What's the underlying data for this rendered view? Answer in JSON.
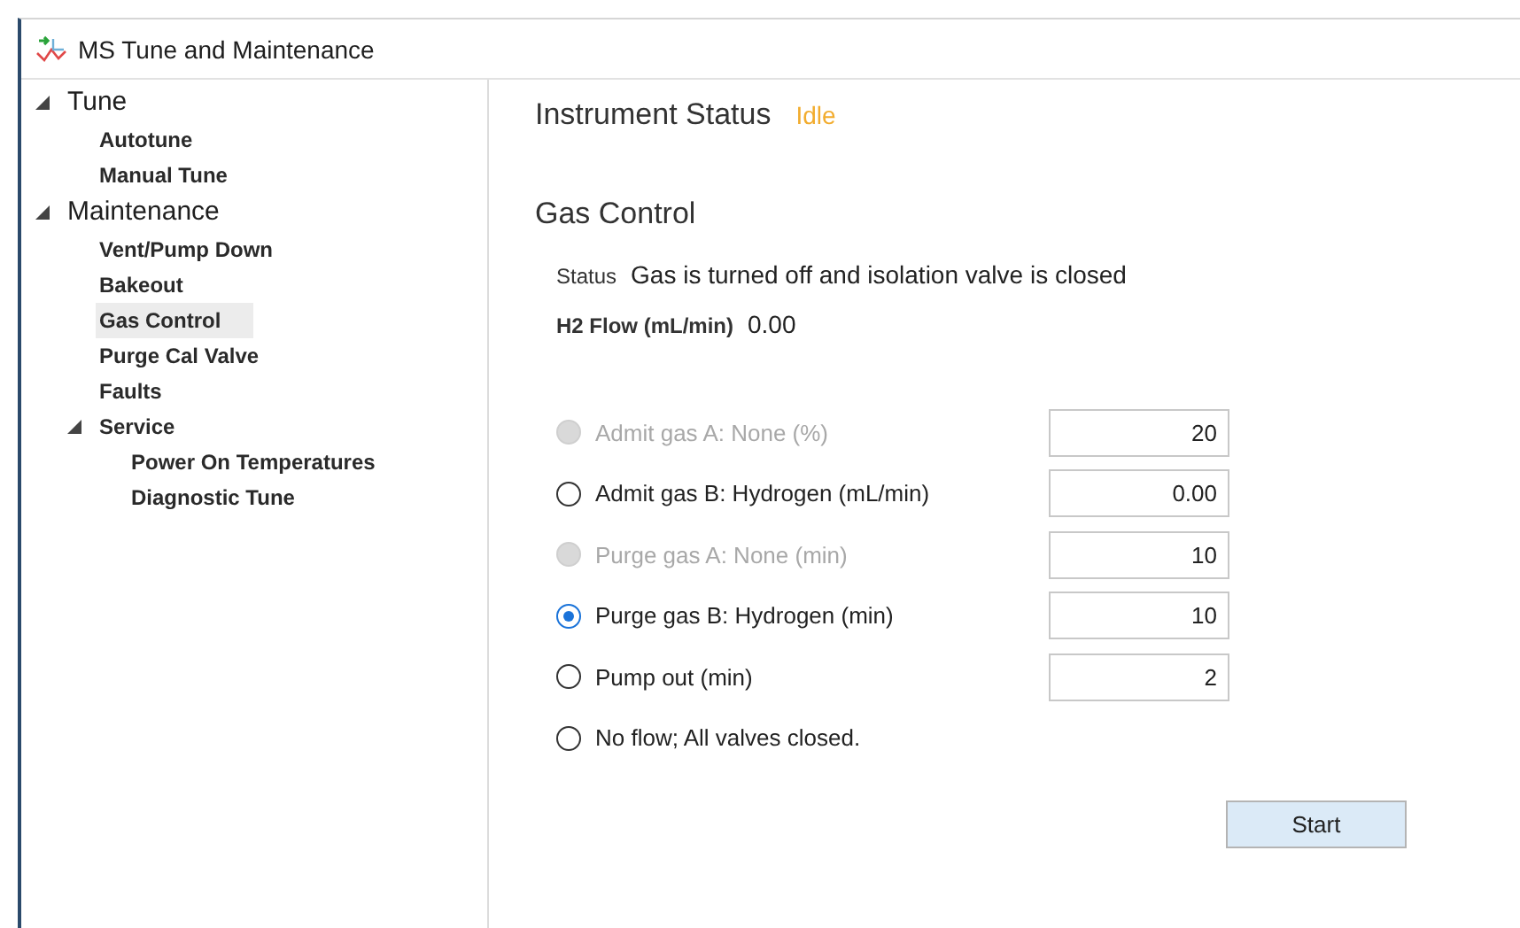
{
  "window": {
    "title": "MS Tune and Maintenance"
  },
  "tree": [
    {
      "label": "Tune",
      "expanded": true,
      "selected": false,
      "children": [
        {
          "label": "Autotune",
          "selected": false
        },
        {
          "label": "Manual Tune",
          "selected": false
        }
      ]
    },
    {
      "label": "Maintenance",
      "expanded": true,
      "selected": false,
      "children": [
        {
          "label": "Vent/Pump Down",
          "selected": false
        },
        {
          "label": "Bakeout",
          "selected": false
        },
        {
          "label": "Gas Control",
          "selected": true
        },
        {
          "label": "Purge Cal Valve",
          "selected": false
        },
        {
          "label": "Faults",
          "selected": false
        },
        {
          "label": "Service",
          "expanded": true,
          "selected": false,
          "children": [
            {
              "label": "Power On Temperatures",
              "selected": false
            },
            {
              "label": "Diagnostic Tune",
              "selected": false
            }
          ]
        }
      ]
    }
  ],
  "instrument_status": {
    "label": "Instrument Status",
    "value": "Idle"
  },
  "section_title": "Gas Control",
  "status": {
    "label": "Status",
    "value": "Gas is turned off and isolation valve is closed"
  },
  "h2_flow": {
    "label": "H2 Flow (mL/min)",
    "value": "0.00"
  },
  "options": [
    {
      "label": "Admit gas A: None (%)",
      "selected": false,
      "disabled": true,
      "value": "20"
    },
    {
      "label": "Admit gas B: Hydrogen (mL/min)",
      "selected": false,
      "disabled": false,
      "value": "0.00"
    },
    {
      "label": "Purge gas A: None (min)",
      "selected": false,
      "disabled": true,
      "value": "10"
    },
    {
      "label": "Purge gas B: Hydrogen (min)",
      "selected": true,
      "disabled": false,
      "value": "10"
    },
    {
      "label": "Pump out (min)",
      "selected": false,
      "disabled": false,
      "value": "2"
    },
    {
      "label": "No flow; All valves closed.",
      "selected": false,
      "disabled": false
    }
  ],
  "start_button": "Start"
}
